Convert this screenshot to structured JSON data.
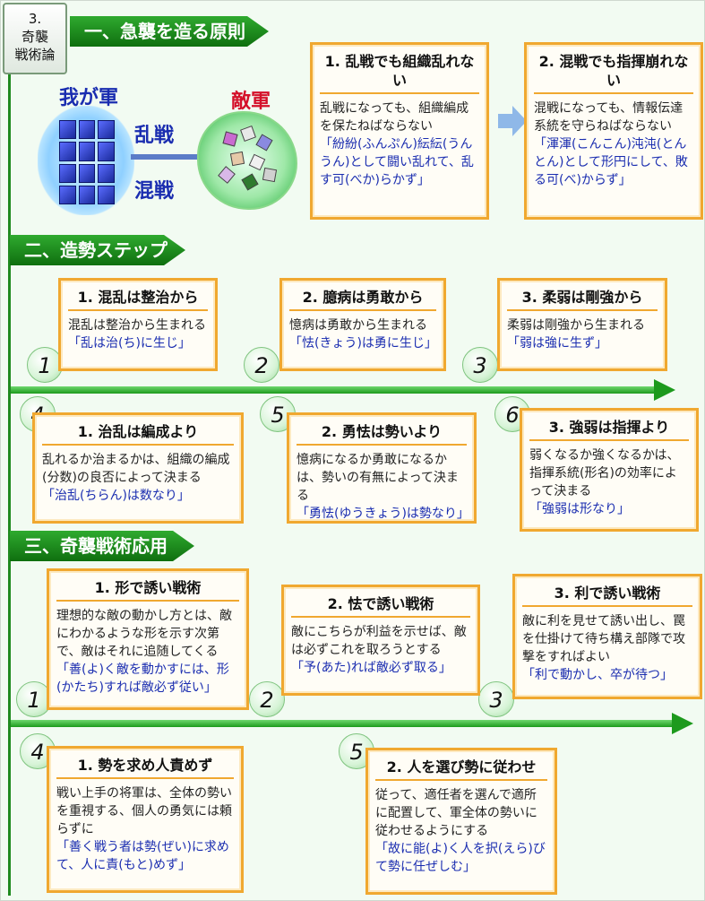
{
  "header": {
    "badge_num": "3.",
    "badge_line1": "奇襲",
    "badge_line2": "戦術論"
  },
  "sections": {
    "s1": "一、急襲を造る原則",
    "s2": "二、造勢ステップ",
    "s3": "三、奇襲戦術応用"
  },
  "illustration": {
    "our_army": "我が軍",
    "enemy": "敵軍",
    "melee1": "乱戦",
    "melee2": "混戦"
  },
  "principles": [
    {
      "title": "1. 乱戦でも組織乱れない",
      "desc": "乱戦になっても、組織編成を保たねばならない",
      "quote": "「紛紛(ふんぷん)紜紜(うんうん)として闘い乱れて、乱す可(べか)らかず」"
    },
    {
      "title": "2. 混戦でも指揮崩れない",
      "desc": "混戦になっても、情報伝達系統を守らねばならない",
      "quote": "「渾渾(こんこん)沌沌(とんとん)として形円にして、敗る可(べ)からず」"
    }
  ],
  "steps_top": [
    {
      "num": "1",
      "title": "1. 混乱は整治から",
      "desc": "混乱は整治から生まれる",
      "quote": "「乱は治(ち)に生じ」"
    },
    {
      "num": "2",
      "title": "2. 臆病は勇敢から",
      "desc": "憶病は勇敢から生まれる",
      "quote": "「怯(きょう)は勇に生じ」"
    },
    {
      "num": "3",
      "title": "3. 柔弱は剛強から",
      "desc": "柔弱は剛強から生まれる",
      "quote": "「弱は強に生ず」"
    }
  ],
  "steps_bottom": [
    {
      "num": "4",
      "title": "1. 治乱は編成より",
      "desc": "乱れるか治まるかは、組織の編成(分数)の良否によって決まる",
      "quote": "「治乱(ちらん)は数なり」"
    },
    {
      "num": "5",
      "title": "2. 勇怯は勢いより",
      "desc": "憶病になるか勇敢になるかは、勢いの有無によって決まる",
      "quote": "「勇怯(ゆうきょう)は勢なり」"
    },
    {
      "num": "6",
      "title": "3. 強弱は指揮より",
      "desc": "弱くなるか強くなるかは、指揮系統(形名)の効率によって決まる",
      "quote": "「強弱は形なり」"
    }
  ],
  "tactics_top": [
    {
      "num": "1",
      "title": "1. 形で誘い戦術",
      "desc": "理想的な敵の動かし方とは、敵にわかるような形を示す次第で、敵はそれに追随してくる",
      "quote": "「善(よ)く敵を動かすには、形(かたち)すれば敵必ず従い」"
    },
    {
      "num": "2",
      "title": "2. 怯で誘い戦術",
      "desc": "敵にこちらが利益を示せば、敵は必ずこれを取ろうとする",
      "quote": "「予(あた)れば敵必ず取る」"
    },
    {
      "num": "3",
      "title": "3. 利で誘い戦術",
      "desc": "敵に利を見せて誘い出し、罠を仕掛けて待ち構え部隊で攻撃をすればよい",
      "quote": "「利で動かし、卒が待つ」"
    }
  ],
  "tactics_bottom": [
    {
      "num": "4",
      "title": "1. 勢を求め人責めず",
      "desc": "戦い上手の将軍は、全体の勢いを重視する、個人の勇気には頼らずに",
      "quote": "「善く戦う者は勢(ぜい)に求めて、人に責(もと)めず」"
    },
    {
      "num": "5",
      "title": "2. 人を選び勢に従わせ",
      "desc": "従って、適任者を選んで適所に配置して、軍全体の勢いに従わせるようにする",
      "quote": "「故に能(よ)く人を択(えら)びて勢に任ぜしむ」"
    }
  ]
}
